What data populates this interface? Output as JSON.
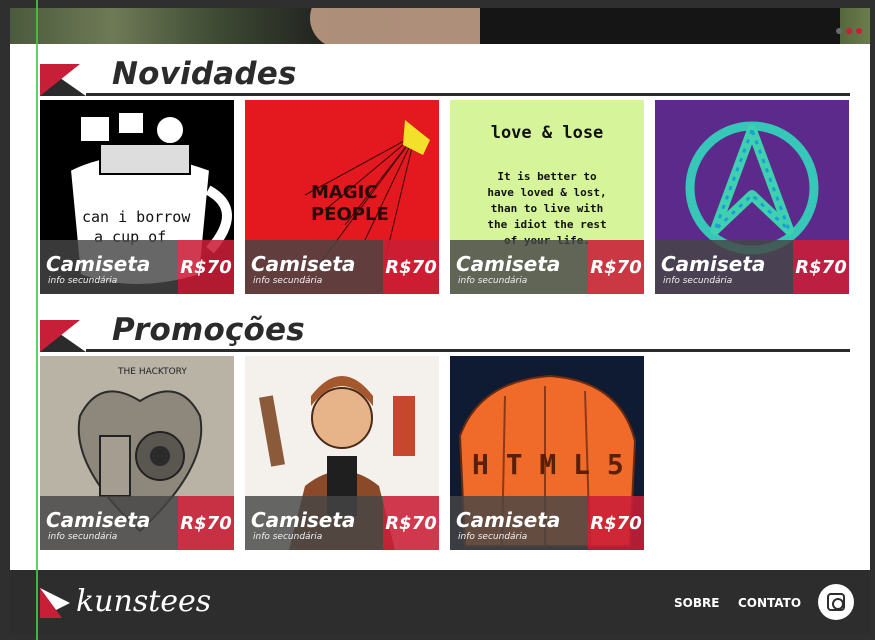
{
  "colors": {
    "accent": "#c71f37",
    "dark": "#2b2b2b",
    "footer": "#2d2d2d"
  },
  "novidades": {
    "title": "Novidades",
    "cards": [
      {
        "name": "Camiseta",
        "sub": "info secundária",
        "price": "R$70",
        "art_text_1": "can i borrow",
        "art_text_2": "a cup of"
      },
      {
        "name": "Camiseta",
        "sub": "info secundária",
        "price": "R$70",
        "art_text_1": "MAGIC",
        "art_text_2": "PEOPLE"
      },
      {
        "name": "Camiseta",
        "sub": "info secundária",
        "price": "R$70",
        "art_text_1": "love & lose",
        "art_text_2": "It is better to",
        "art_text_3": "have loved & lost,",
        "art_text_4": "than to live with",
        "art_text_5": "the idiot the rest",
        "art_text_6": "of your life."
      },
      {
        "name": "Camiseta",
        "sub": "info secundária",
        "price": "R$70"
      }
    ]
  },
  "promocoes": {
    "title": "Promoções",
    "cards": [
      {
        "name": "Camiseta",
        "sub": "info secundária",
        "price": "R$70",
        "art_text_1": "THE HACKTORY"
      },
      {
        "name": "Camiseta",
        "sub": "info secundária",
        "price": "R$70"
      },
      {
        "name": "Camiseta",
        "sub": "info secundária",
        "price": "R$70",
        "art_text_1": "H  T  M  L  5"
      }
    ]
  },
  "footer": {
    "brand": "kunstees",
    "nav_sobre": "SOBRE",
    "nav_contato": "CONTATO",
    "social_icon": "instagram-icon"
  }
}
